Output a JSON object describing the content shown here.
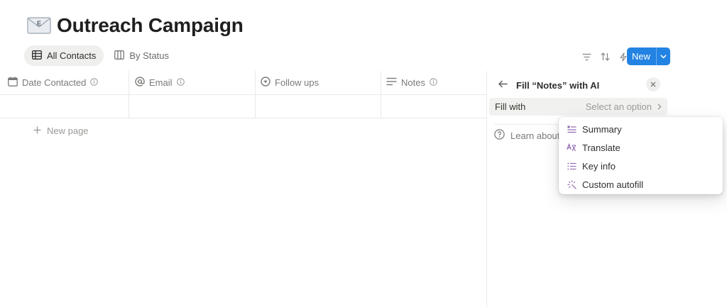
{
  "page": {
    "icon": "envelope-icon",
    "title": "Outreach Campaign"
  },
  "views": [
    {
      "label": "All Contacts",
      "icon": "table-icon",
      "active": true
    },
    {
      "label": "By Status",
      "icon": "board-icon",
      "active": false
    }
  ],
  "toolbar": {
    "icons": [
      "filter-icon",
      "sort-icon",
      "automation-bolt-icon",
      "search-icon",
      "settings-sliders-icon"
    ],
    "new_label": "New"
  },
  "table": {
    "columns": [
      {
        "label": "Date Contacted",
        "icon": "calendar-icon"
      },
      {
        "label": "Email",
        "icon": "at-icon"
      },
      {
        "label": "Follow ups",
        "icon": "status-icon"
      },
      {
        "label": "Notes",
        "icon": "text-lines-icon"
      }
    ],
    "new_page_label": "New page"
  },
  "panel": {
    "title": "Fill “Notes” with AI",
    "fill_label": "Fill with",
    "fill_placeholder": "Select an option",
    "learn_label": "Learn about"
  },
  "dropdown": {
    "items": [
      {
        "label": "Summary",
        "icon": "summary-icon"
      },
      {
        "label": "Translate",
        "icon": "translate-icon"
      },
      {
        "label": "Key info",
        "icon": "list-icon"
      },
      {
        "label": "Custom autofill",
        "icon": "sparkle-icon"
      }
    ]
  },
  "colors": {
    "accent": "#2383e2",
    "ai_purple": "#9065b0"
  }
}
